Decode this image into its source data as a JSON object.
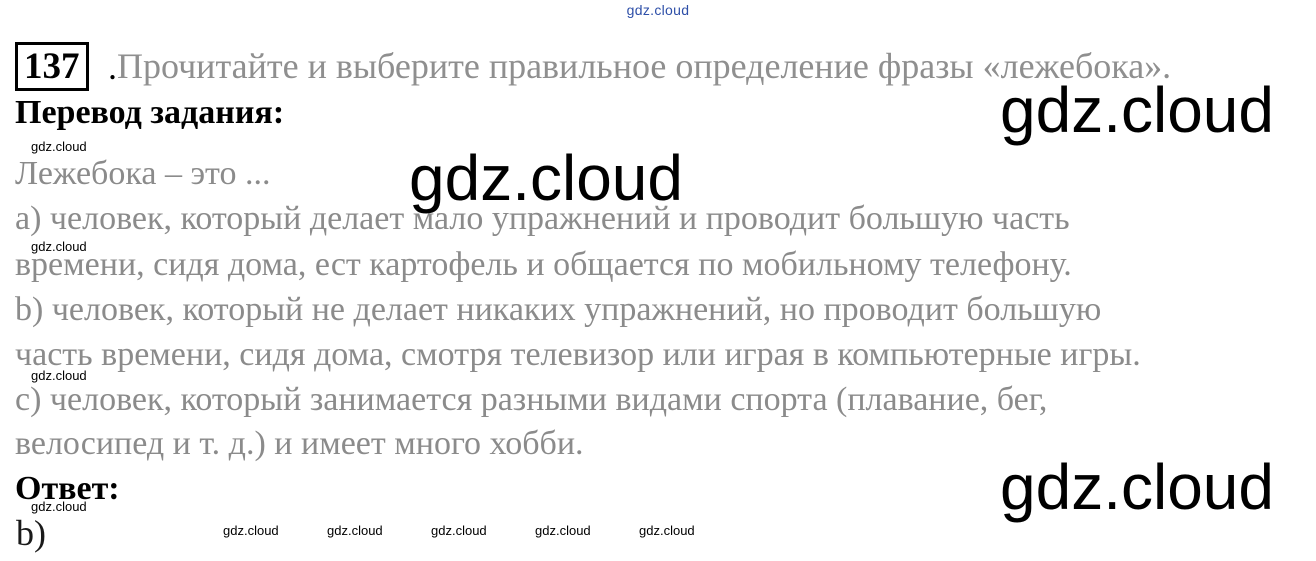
{
  "watermark": {
    "text": "gdz.cloud"
  },
  "task": {
    "number": "137",
    "dot": ".",
    "text": "Прочитайте и выберите правильное определение фразы «лежебока»."
  },
  "translation": {
    "heading": "Перевод задания:",
    "lead": "Лежебока – это ...",
    "lines": [
      "а) человек, который делает мало упражнений и проводит большую часть",
      "времени, сидя дома, ест картофель и общается по мобильному телефону.",
      "b) человек, который не делает никаких упражнений, но проводит большую",
      "часть времени, сидя дома, смотря телевизор или играя в компьютерные игры.",
      "с) человек, который занимается разными видами спорта (плавание, бег,",
      "велосипед и т. д.) и имеет много хобби."
    ]
  },
  "answer": {
    "heading": "Ответ:",
    "value": "b)"
  }
}
